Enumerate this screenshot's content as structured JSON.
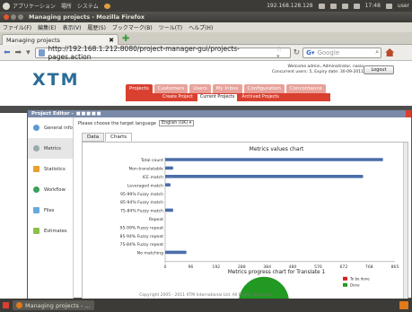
{
  "top_panel": {
    "menus": [
      "アプリケーション",
      "場所",
      "システム"
    ],
    "ip": "192.168.128.128",
    "time": "17:48",
    "user": "user"
  },
  "window": {
    "title": "Managing projects - Mozilla Firefox"
  },
  "menubar": {
    "items": [
      "ファイル(F)",
      "編集(E)",
      "表示(V)",
      "履歴(S)",
      "ブックマーク(B)",
      "ツール(T)",
      "ヘルプ(H)"
    ]
  },
  "tab": {
    "title": "Managing projects",
    "close": "✖"
  },
  "nav": {
    "url": "http://192.168.1.212:8080/project-manager-gui/projects-pages.action",
    "search_placeholder": "Google"
  },
  "xtm": {
    "logo": "XTM",
    "welcome_line1": "Welcome admin, Administrator, nasio",
    "welcome_line2": "Concurrent users: 5, Expiry date: 30-09-2011",
    "logout": "Logout",
    "main_tabs": [
      "Projects",
      "Customers",
      "Users",
      "My Inbox",
      "Configuration",
      "Concordance"
    ],
    "sub_tabs": [
      "Create Project",
      "Current Projects",
      "Archived Projects"
    ],
    "footer": "Copyright 2005 - 2011 XTM International Ltd. All Rights Reserved."
  },
  "dialog": {
    "title": "Project Editor -",
    "language_label": "Please choose the target language",
    "language_value": "English (UK)",
    "content_tabs": [
      "Data",
      "Charts"
    ],
    "sidebar": [
      {
        "label": "General info",
        "icon": "info-icon"
      },
      {
        "label": "Metrics",
        "icon": "metrics-icon"
      },
      {
        "label": "Statistics",
        "icon": "statistics-icon"
      },
      {
        "label": "Workflow",
        "icon": "workflow-icon"
      },
      {
        "label": "Files",
        "icon": "files-icon"
      },
      {
        "label": "Estimates",
        "icon": "estimates-icon"
      }
    ]
  },
  "chart_data": [
    {
      "type": "bar",
      "orientation": "horizontal",
      "title": "Metrics values chart",
      "categories": [
        "Total count",
        "Non-translatable",
        "ICE match",
        "Leveraged match",
        "95-99% Fuzzy match",
        "85-94% Fuzzy match",
        "75-84% Fuzzy match",
        "Repeat",
        "95-99% Fuzzy repeat",
        "85-94% Fuzzy repeat",
        "75-84% Fuzzy repeat",
        "No matching"
      ],
      "values": [
        820,
        30,
        745,
        20,
        0,
        0,
        30,
        0,
        0,
        0,
        0,
        80
      ],
      "xlim": [
        0,
        865
      ],
      "xticks": [
        0,
        96,
        192,
        288,
        384,
        480,
        576,
        672,
        768,
        865
      ],
      "bar_color": "#4a6ea9"
    },
    {
      "type": "pie",
      "title": "Metrics progress chart for Translate 1",
      "legend": [
        "To be done",
        "Done"
      ],
      "colors": [
        "#cc2222",
        "#229922"
      ]
    }
  ]
}
